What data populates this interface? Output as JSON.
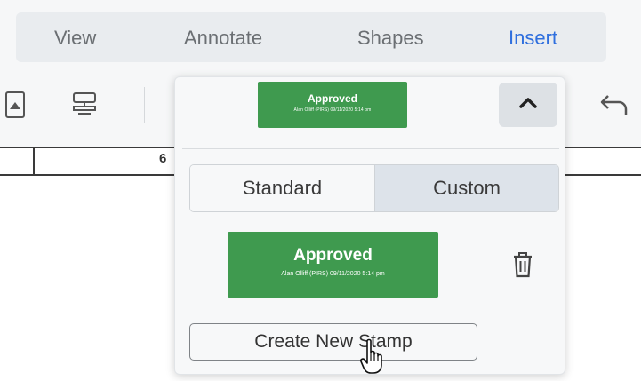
{
  "menu": {
    "tabs": [
      {
        "label": "View"
      },
      {
        "label": "Annotate"
      },
      {
        "label": "Shapes"
      },
      {
        "label": "Insert"
      }
    ],
    "active_color": "#2f6fde"
  },
  "toolbar": {
    "icons": [
      "image-icon",
      "signature-icon",
      "undo-icon"
    ]
  },
  "document": {
    "cell_number": "6"
  },
  "stamp_panel": {
    "selected_stamp": {
      "title": "Approved",
      "subtitle": "Alan Olliff (PIRS) 09/11/2020 5:14 pm"
    },
    "collapse_icon": "chevron-up-icon",
    "tabs": {
      "standard": "Standard",
      "custom": "Custom"
    },
    "active_tab": "Custom",
    "custom_stamps": [
      {
        "title": "Approved",
        "subtitle": "Alan Olliff (PIRS) 09/11/2020 5:14 pm"
      }
    ],
    "delete_icon": "trash-icon",
    "create_button": "Create New Stamp",
    "stamp_color": "#3f9a4f"
  }
}
